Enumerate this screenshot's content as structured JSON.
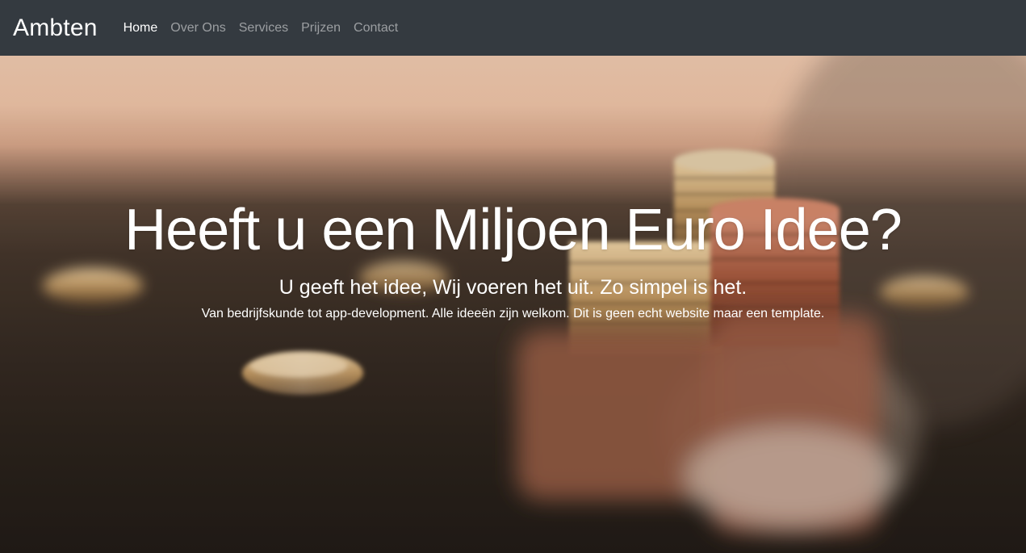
{
  "navbar": {
    "brand": "Ambten",
    "items": [
      {
        "label": "Home",
        "active": true
      },
      {
        "label": "Over Ons",
        "active": false
      },
      {
        "label": "Services",
        "active": false
      },
      {
        "label": "Prijzen",
        "active": false
      },
      {
        "label": "Contact",
        "active": false
      }
    ]
  },
  "hero": {
    "title": "Heeft u een Miljoen Euro Idee?",
    "subtitle": "U geeft het idee, Wij voeren het uit. Zo simpel is het.",
    "lead": "Van bedrijfskunde tot app-development. Alle ideeën zijn welkom. Dit is geen echt website maar een template."
  },
  "colors": {
    "navbar_bg": "#343a40",
    "nav_active": "#ffffff",
    "nav_inactive": "rgba(255,255,255,0.5)"
  }
}
